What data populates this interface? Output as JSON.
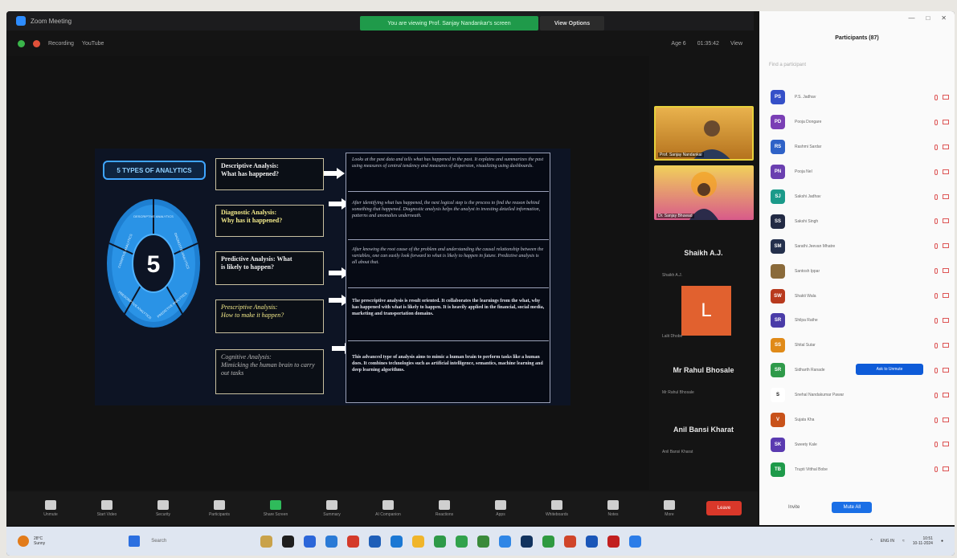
{
  "window": {
    "app_title": "Zoom Meeting",
    "share_banner": "You are viewing Prof. Sanjay Nandankar's screen",
    "view_options": "View Options"
  },
  "meeting_bar": {
    "security_label": "Recording",
    "recording_label": "",
    "youtube_label": "YouTube",
    "gallery": "Age 6",
    "timer": "01:35:42",
    "view": "View"
  },
  "slide": {
    "title": "5 TYPES OF ANALYTICS",
    "center_number": "5",
    "wheel_segments": [
      "DESCRIPTIVE ANALYTICS",
      "DIAGNOSTIC ANALYTICS",
      "PREDICTIVE ANALYTICS",
      "PRESCRIPTIVE ANALYTICS",
      "COGNITIVE ANALYTICS"
    ],
    "types": [
      {
        "line1": "Descriptive Analysis:",
        "line2": "What has happened?"
      },
      {
        "line1": "Diagnostic Analysis:",
        "line2": "Why has it happened?"
      },
      {
        "line1": "Predictive Analysis: What",
        "line2": "is likely to happen?"
      },
      {
        "line1": "Prescriptive Analysis:",
        "line2": "How to make it happen?"
      },
      {
        "line1": "Cognitive Analysis:",
        "line2": "Mimicking the human brain to carry out tasks"
      }
    ],
    "descriptions": [
      "Looks at the past data and tells what has happened in the past. It explains and summarizes the past using measures of central tendency and measures of dispersion, visualizing using dashboards.",
      "After identifying what has happened, the next logical step is the process to find the reason behind something that happened. Diagnostic analysis helps the analyst in investing detailed information, patterns and anomalies underneath.",
      "After knowing the root cause of the problem and understanding the causal relationship between the variables, one can easily look forward to what is likely to happen in future. Predictive analysis is all about that.",
      "The prescriptive analysis is result oriented. It collaborates the learnings from the what, why has happened with what is likely to happen. It is heavily applied in the financial, social media, marketing and transportation domains.",
      "This advanced type of analysis aims to mimic a human brain to perform tasks like a human does. It combines technologies such as artificial intelligence, semantics, machine learning and deep learning algorithms."
    ]
  },
  "gallery": {
    "tile1_name": "Prof. Sanjay Nandankar",
    "tile2_name": "Dr. Sanjay Bhuwad",
    "name_tiles": [
      {
        "name": "Shaikh A.J.",
        "sub": "Shaikh A.J."
      },
      {
        "name": "",
        "sub": "Lalit Dhobe"
      },
      {
        "name": "Mr Rahul Bhosale",
        "sub": "Mr Rahul Bhosale"
      },
      {
        "name": "Anil Bansi Kharat",
        "sub": "Anil Bansi Kharat"
      }
    ],
    "avatar_letter": "L"
  },
  "toolbar": {
    "items": [
      "Unmute",
      "Start Video",
      "Security",
      "Participants",
      "Share Screen",
      "Summary",
      "AI Companion",
      "Reactions",
      "Apps",
      "Whiteboards",
      "Notes",
      "More"
    ],
    "leave": "Leave"
  },
  "panel": {
    "title": "Participants (87)",
    "search_placeholder": "Find a participant",
    "participants": [
      {
        "initials": "PS",
        "name": "P.S. Jadhav",
        "color": "#3550c8"
      },
      {
        "initials": "PD",
        "name": "Pooja Dongare",
        "color": "#7a3fb5"
      },
      {
        "initials": "RS",
        "name": "Rashmi Sardar",
        "color": "#2f62c7"
      },
      {
        "initials": "PN",
        "name": "Pooja Nel",
        "color": "#6a3fb0"
      },
      {
        "initials": "SJ",
        "name": "Sakshi Jadhav",
        "color": "#1b9a8a"
      },
      {
        "initials": "SS",
        "name": "Sakshi Singh",
        "color": "#222a44"
      },
      {
        "initials": "SM",
        "name": "Sarathi Jeevan Mhatre",
        "color": "#24304c"
      },
      {
        "initials": "",
        "name": "Santosh Ippar",
        "color": "#8a6a3a"
      },
      {
        "initials": "SW",
        "name": "Shakti Wala",
        "color": "#b83a1e"
      },
      {
        "initials": "SR",
        "name": "Shilpa Rathe",
        "color": "#4a3ca8"
      },
      {
        "initials": "SS",
        "name": "Shital Sutar",
        "color": "#e08a18"
      },
      {
        "initials": "SR",
        "name": "Sidharth Ranade",
        "color": "#2f9a4a"
      },
      {
        "initials": "S",
        "name": "Snehal Nandakumar Pawar",
        "color": "#ffffff"
      },
      {
        "initials": "V",
        "name": "Sujata Kha",
        "color": "#c8521a"
      },
      {
        "initials": "SK",
        "name": "Sweety Kale",
        "color": "#5a3ab0"
      },
      {
        "initials": "TB",
        "name": "Trupti Vitthal Bobe",
        "color": "#1e9a4a"
      }
    ],
    "ask_to_unmute": "Ask to Unmute",
    "footer_invite": "Invite",
    "footer_button": "Mute All"
  },
  "taskbar": {
    "weather_temp": "28°C",
    "weather_desc": "Sunny",
    "search_placeholder": "Search",
    "tray_lang": "ENG IN",
    "time": "10:51",
    "date": "10-11-2024"
  },
  "colors": {
    "accent_blue": "#2d8cff",
    "leave_red": "#d9382a",
    "share_green": "#1f9a4a",
    "avatar_orange": "#e1612f"
  }
}
